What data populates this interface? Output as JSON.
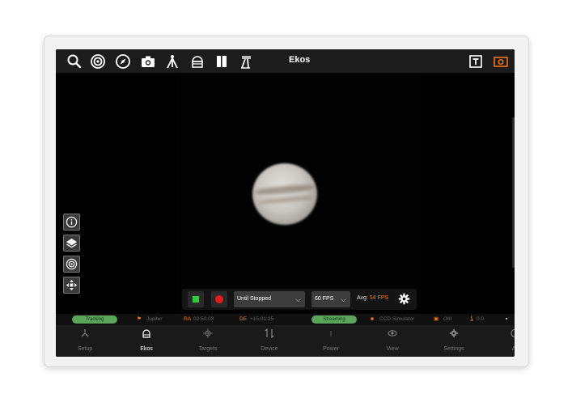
{
  "app": {
    "title": "Ekos"
  },
  "toolbar_icons": [
    "search-icon",
    "target-icon",
    "compass-icon",
    "camera-icon",
    "telescope-icon",
    "observatory-icon",
    "book-icon",
    "tripod-icon"
  ],
  "toolbar_right_icons": [
    "text-icon",
    "frame-icon"
  ],
  "colors": {
    "accent": "#ff7a1a",
    "stop": "#2ecc40",
    "record": "#e8191e",
    "tracking": "#5aa55a"
  },
  "side_tools": [
    "info-icon",
    "layers-icon",
    "crosshair-target-icon",
    "move-icon"
  ],
  "controls": {
    "duration": "Until Stopped",
    "fps": "60 FPS",
    "avg_label": "Avg:",
    "avg_value": "54 FPS"
  },
  "status": {
    "tracking": "Tracking",
    "target": "Jupiter",
    "ra_label": "RA",
    "ra_value": "02:50:03",
    "de_label": "DE",
    "de_value": "+15:01:25",
    "streaming": "Streaming",
    "camera": "CCD Simulator",
    "filter": "OIII",
    "temp": "0.0"
  },
  "nav": [
    {
      "label": "Setup",
      "icon": "setup-icon"
    },
    {
      "label": "Ekos",
      "icon": "ekos-icon",
      "active": true
    },
    {
      "label": "Targets",
      "icon": "targets-icon"
    },
    {
      "label": "Device",
      "icon": "device-icon"
    },
    {
      "label": "Power",
      "icon": "power-icon"
    },
    {
      "label": "View",
      "icon": "view-icon"
    },
    {
      "label": "Settings",
      "icon": "settings-icon"
    },
    {
      "label": "Ab",
      "icon": "about-icon"
    }
  ]
}
